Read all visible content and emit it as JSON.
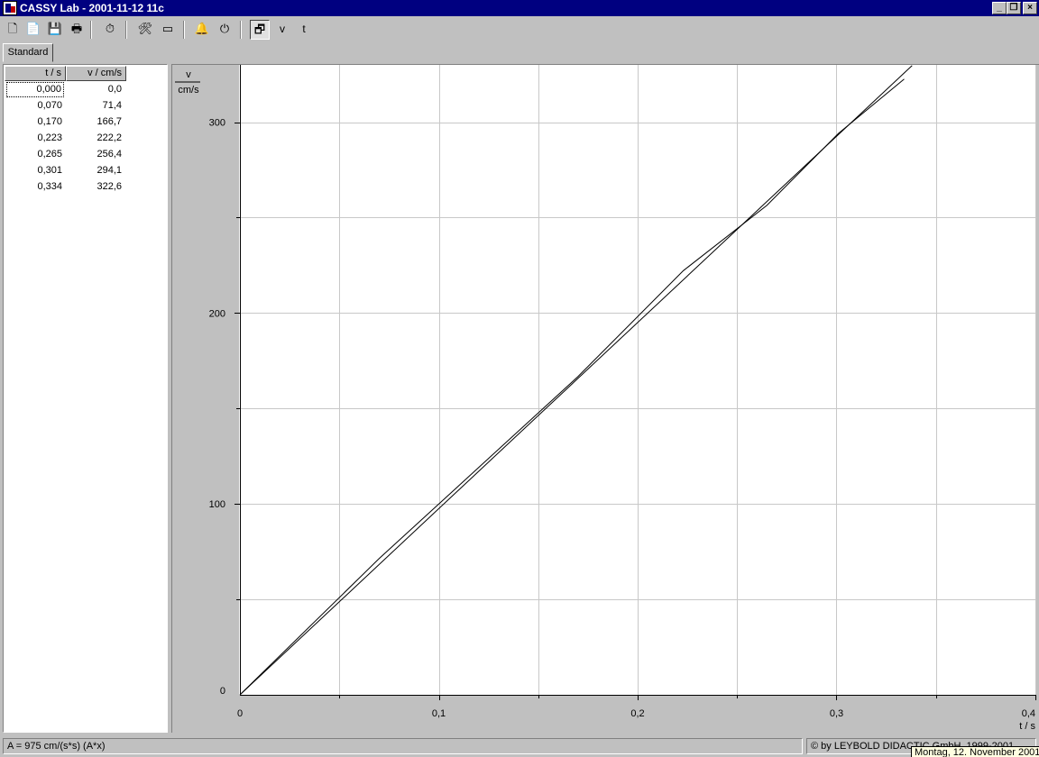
{
  "window": {
    "title": "CASSY Lab - 2001-11-12 11c",
    "minimize_glyph": "_",
    "restore_glyph": "❐",
    "close_glyph": "×"
  },
  "toolbar": {
    "buttons": [
      {
        "name": "new-file-icon",
        "glyph": "🗋"
      },
      {
        "name": "open-file-icon",
        "glyph": "📄"
      },
      {
        "name": "save-file-icon",
        "glyph": "💾"
      },
      {
        "name": "print-icon",
        "glyph": "🖶"
      },
      {
        "name": "stopwatch-icon",
        "glyph": "⏱"
      },
      {
        "name": "settings-tools-icon",
        "glyph": "🛠"
      },
      {
        "name": "display-window-icon",
        "glyph": "▭"
      },
      {
        "name": "bell-icon",
        "glyph": "🔔"
      },
      {
        "name": "power-icon",
        "glyph": "⏻"
      },
      {
        "name": "windows-icon",
        "glyph": "🗗"
      }
    ],
    "text_buttons": [
      "v",
      "t"
    ]
  },
  "tabs": [
    "Standard"
  ],
  "table": {
    "columns": [
      "t / s",
      "v / cm/s"
    ],
    "rows": [
      [
        "0,000",
        "0,0"
      ],
      [
        "0,070",
        "71,4"
      ],
      [
        "0,170",
        "166,7"
      ],
      [
        "0,223",
        "222,2"
      ],
      [
        "0,265",
        "256,4"
      ],
      [
        "0,301",
        "294,1"
      ],
      [
        "0,334",
        "322,6"
      ]
    ]
  },
  "chart_data": {
    "type": "line",
    "y_axis_symbol": "v",
    "y_axis_unit": "cm/s",
    "x_axis_label": "t / s",
    "xlim": [
      0,
      0.4
    ],
    "ylim": [
      0,
      330
    ],
    "x_ticks": [
      "0",
      "0,1",
      "0,2",
      "0,3",
      "0,4"
    ],
    "x_tick_values": [
      0,
      0.1,
      0.2,
      0.3,
      0.4
    ],
    "y_ticks": [
      "0",
      "100",
      "200",
      "300"
    ],
    "y_tick_values": [
      0,
      100,
      200,
      300
    ],
    "grid": true,
    "series": [
      {
        "x": [
          0.0,
          0.07,
          0.17,
          0.223,
          0.265,
          0.301,
          0.334
        ],
        "y": [
          0.0,
          71.4,
          166.7,
          222.2,
          256.4,
          294.1,
          322.6
        ]
      },
      {
        "fit": "A*x",
        "A": 975,
        "x": [
          0,
          0.338
        ],
        "y": [
          0,
          329.6
        ]
      }
    ]
  },
  "status": {
    "fit_result": "A = 975 cm/(s*s)   (A*x)",
    "copyright": "© by LEYBOLD DIDACTIC GmbH, 1999-2001",
    "tooltip": "Montag, 12. November 2001"
  }
}
